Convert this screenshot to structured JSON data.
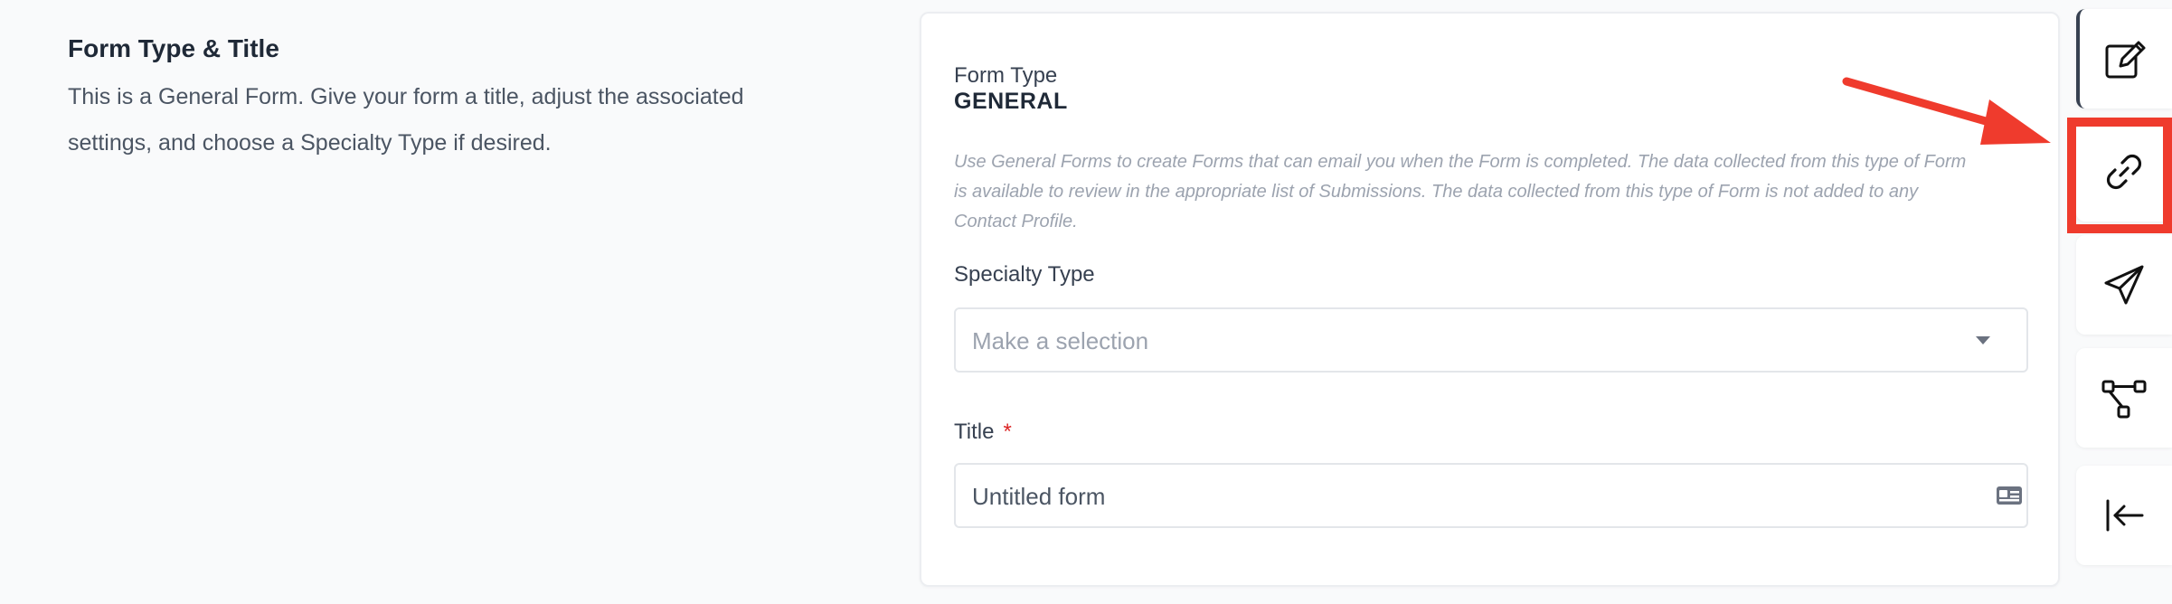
{
  "intro": {
    "title": "Form Type & Title",
    "description_line1": "This is a General Form. Give your form a title, adjust the associated",
    "description_line2": "settings, and choose a Specialty Type if desired."
  },
  "form": {
    "form_type_label": "Form Type",
    "form_type_value": "GENERAL",
    "help_line1": "Use General Forms to create Forms that can email you when the Form is completed. The data collected from this type of Form",
    "help_line2": "is available to review in the appropriate list of Submissions. The data collected from this type of Form is not added to any",
    "help_line3": "Contact Profile.",
    "specialty_label": "Specialty Type",
    "specialty_placeholder": "Make a selection",
    "title_label": "Title",
    "title_required_mark": "*",
    "title_value": "Untitled form"
  },
  "toolbar": {
    "items": [
      {
        "icon": "edit-icon",
        "active": true
      },
      {
        "icon": "link-icon",
        "active": false,
        "highlighted": true
      },
      {
        "icon": "send-icon",
        "active": false
      },
      {
        "icon": "workflow-icon",
        "active": false
      },
      {
        "icon": "collapse-icon",
        "active": false
      }
    ]
  },
  "annotation": {
    "color": "#ef3b2d"
  }
}
